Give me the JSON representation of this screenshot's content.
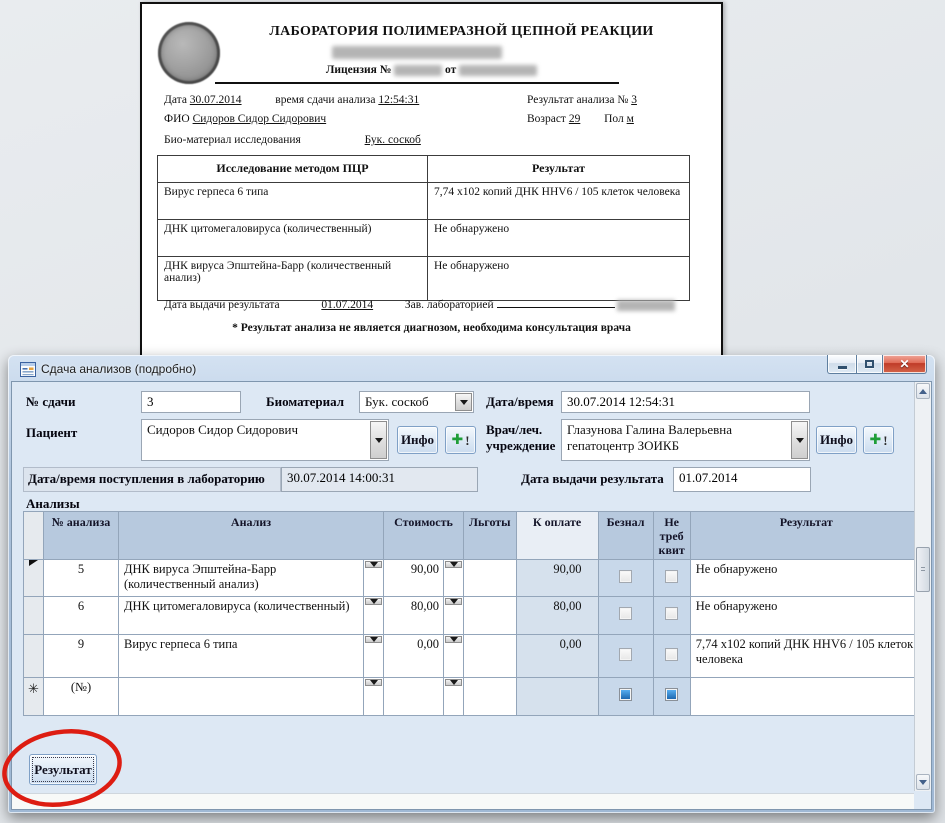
{
  "colors": {
    "annotation": "#dd1d12",
    "close_button": "#c03b28",
    "client_bg": "#dde8f4",
    "grid_header_bg": "#b7c9de"
  },
  "report": {
    "title": "ЛАБОРАТОРИЯ ПОЛИМЕРАЗНОЙ ЦЕПНОЙ РЕАКЦИИ",
    "license_label": "Лицензия №",
    "license_from": "от",
    "date_label": "Дата",
    "date": "30.07.2014",
    "time_label": "время сдачи анализа",
    "time": "12:54:31",
    "result_no_label": "Результат анализа №",
    "result_no": "3",
    "fio_label": "ФИО",
    "fio": "Сидоров Сидор Сидорович",
    "age_label": "Возраст",
    "age": "29",
    "sex_label": "Пол",
    "sex": "м",
    "biomaterial_label": "Био-материал исследования",
    "biomaterial": "Бук. соскоб",
    "table": {
      "col1": "Исследование методом ПЦР",
      "col2": "Результат",
      "rows": [
        {
          "test": "Вирус герпеса 6 типа",
          "result": "7,74 x102  копий ДНК HHV6 / 105 клеток человека"
        },
        {
          "test": "ДНК цитомегаловируса (количественный)",
          "result": "Не обнаружено"
        },
        {
          "test": "ДНК вируса Эпштейна-Барр (количественный анализ)",
          "result": "Не обнаружено"
        }
      ]
    },
    "issue_date_label": "Дата выдачи результата",
    "issue_date": "01.07.2014",
    "head_label": "Зав.  лабораторией",
    "footnote": "* Результат анализа не является диагнозом, необходима консультация врача"
  },
  "window": {
    "title": "Сдача анализов (подробно)",
    "submission_no_label": "№ сдачи",
    "submission_no": "3",
    "biomaterial_label": "Биоматериал",
    "biomaterial": "Бук. соскоб",
    "datetime_label": "Дата/время",
    "datetime": "30.07.2014 12:54:31",
    "patient_label": "Пациент",
    "patient": "Сидоров Сидор Сидорович",
    "doctor_label": "Врач/леч. учреждение",
    "doctor_line1": "Глазунова Галина Валерьевна",
    "doctor_line2": "гепатоцентр ЗОИКБ",
    "info_button": "Инфо",
    "lab_received_label": "Дата/время поступления в лабораторию",
    "lab_received": "30.07.2014 14:00:31",
    "issue_date_label": "Дата выдачи результата",
    "issue_date": "01.07.2014",
    "analyses_label": "Анализы",
    "result_button": "Результат",
    "grid": {
      "columns": {
        "num": "№ анализа",
        "analysis": "Анализ",
        "cost": "Стоимость",
        "benefits": "Льготы",
        "to_pay": "К оплате",
        "beznal": "Безнал",
        "no_receipt": "Не треб квит",
        "result": "Результат"
      },
      "rows": [
        {
          "num": "5",
          "analysis": "ДНК вируса Эпштейна-Барр (количественный анализ)",
          "cost": "90,00",
          "benefits": "",
          "to_pay": "90,00",
          "beznal": false,
          "no_receipt": false,
          "result": "Не обнаружено"
        },
        {
          "num": "6",
          "analysis": "ДНК цитомегаловируса (количественный)",
          "cost": "80,00",
          "benefits": "",
          "to_pay": "80,00",
          "beznal": false,
          "no_receipt": false,
          "result": "Не обнаружено"
        },
        {
          "num": "9",
          "analysis": "Вирус герпеса 6 типа",
          "cost": "0,00",
          "benefits": "",
          "to_pay": "0,00",
          "beznal": false,
          "no_receipt": false,
          "result": "7,74 x102  копий ДНК HHV6 / 105 клеток человека"
        },
        {
          "num": "(№)",
          "analysis": "",
          "cost": "",
          "benefits": "",
          "to_pay": "",
          "beznal": true,
          "no_receipt": true,
          "result": ""
        }
      ]
    }
  }
}
